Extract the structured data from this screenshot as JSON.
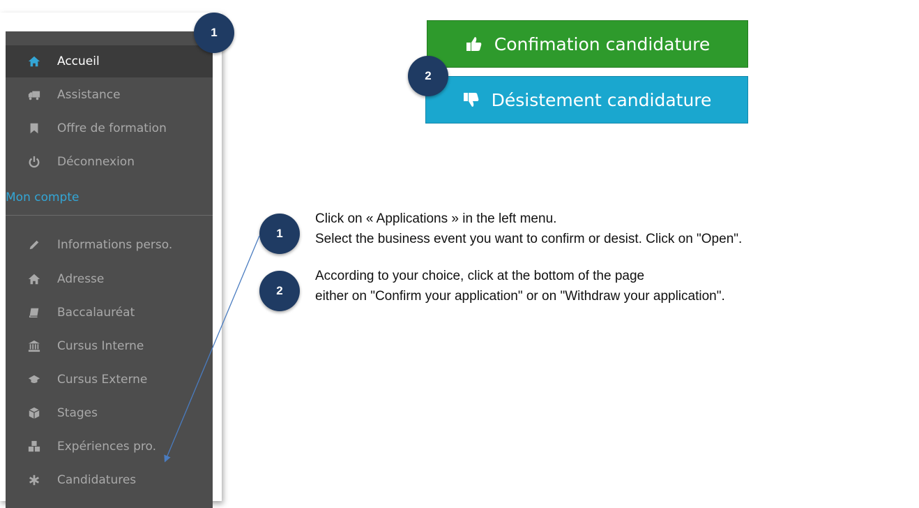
{
  "sidebar": {
    "items": [
      {
        "label": "Accueil",
        "icon": "home-icon",
        "active": true
      },
      {
        "label": "Assistance",
        "icon": "truck-icon"
      },
      {
        "label": "Offre de formation",
        "icon": "bookmark-icon"
      },
      {
        "label": "Déconnexion",
        "icon": "power-icon"
      }
    ],
    "section_title": "Mon compte",
    "account_items": [
      {
        "label": "Informations perso.",
        "icon": "pencil-icon"
      },
      {
        "label": "Adresse",
        "icon": "home-icon"
      },
      {
        "label": "Baccalauréat",
        "icon": "book-icon"
      },
      {
        "label": "Cursus Interne",
        "icon": "university-icon"
      },
      {
        "label": "Cursus Externe",
        "icon": "graduation-cap-icon"
      },
      {
        "label": "Stages",
        "icon": "cube-icon"
      },
      {
        "label": "Expériences pro.",
        "icon": "cubes-icon"
      },
      {
        "label": "Candidatures",
        "icon": "asterisk-icon"
      }
    ]
  },
  "badges": {
    "one": "1",
    "two": "2"
  },
  "buttons": {
    "confirm": {
      "label": "Confimation candidature",
      "icon": "thumbs-up-icon",
      "color": "#2e9a2c"
    },
    "desist": {
      "label": "Désistement candidature",
      "icon": "thumbs-down-icon",
      "color": "#1aa7cf"
    }
  },
  "instructions": {
    "step1": {
      "line1": "Click on « Applications » in the left menu.",
      "line2": "Select the business event you want to confirm or desist. Click on \"Open\"."
    },
    "step2": {
      "line1": "According to your choice, click at the bottom of the page",
      "line2": "either on \"Confirm your application\" or on \"Withdraw your application\"."
    }
  },
  "colors": {
    "badge": "#1f3b63",
    "sidebar_bg": "#4d4d4d",
    "section_title": "#33a6d6",
    "arrow": "#4a7cc0"
  }
}
